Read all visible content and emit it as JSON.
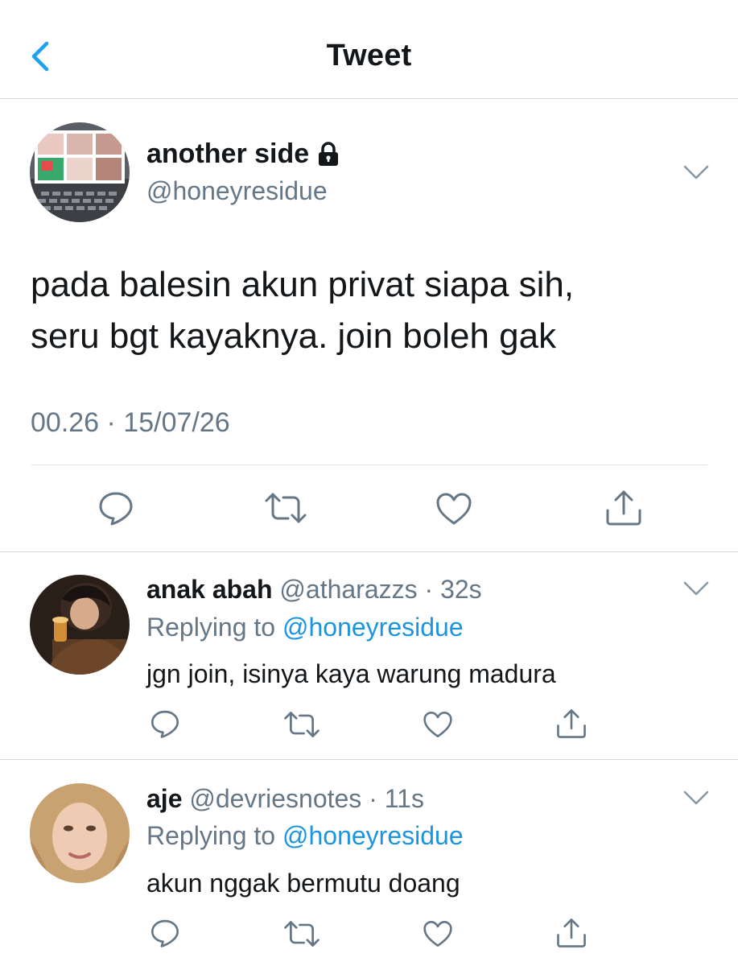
{
  "header": {
    "title": "Tweet",
    "back_icon": "chevron-left-icon",
    "accent_color": "#1da1f2"
  },
  "main_tweet": {
    "name": "another side",
    "lock_icon": "lock-icon",
    "handle": "@honeyresidue",
    "text_line1": "pada balesin akun privat siapa sih,",
    "text_line2": "seru bgt kayaknya. join boleh gak",
    "timestamp": "00.26 · 15/07/26",
    "actions": [
      "reply-icon",
      "retweet-icon",
      "like-icon",
      "share-icon"
    ]
  },
  "replies": [
    {
      "name": "anak abah",
      "handle": "@atharazzs",
      "time": "· 32s",
      "replying_prefix": "Replying to",
      "replying_to": "@honeyresidue",
      "text": "jgn join, isinya kaya warung madura"
    },
    {
      "name": "aje",
      "handle": "@devriesnotes",
      "time": "· 11s",
      "replying_prefix": "Replying to",
      "replying_to": "@honeyresidue",
      "text": "akun nggak bermutu doang"
    }
  ],
  "colors": {
    "text": "#14171a",
    "secondary": "#657786",
    "link": "#1b95e0",
    "divider": "#d6d9dc"
  }
}
